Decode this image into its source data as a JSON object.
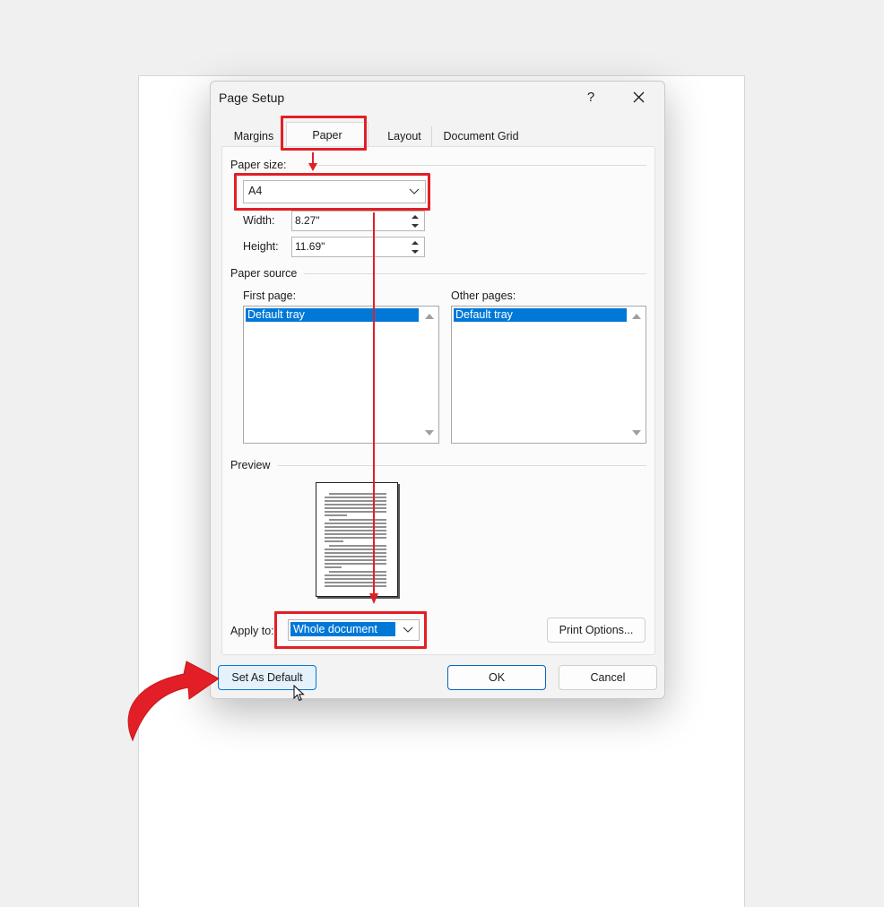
{
  "dialog": {
    "title": "Page Setup",
    "help_label": "?",
    "close_icon": "close-icon"
  },
  "tabs": [
    {
      "label": "Margins"
    },
    {
      "label": "Paper"
    },
    {
      "label": "Layout"
    },
    {
      "label": "Document Grid"
    }
  ],
  "paper_size": {
    "label": "Paper size:",
    "value": "A4",
    "width_label": "Width:",
    "width_value": "8.27\"",
    "height_label": "Height:",
    "height_value": "11.69\""
  },
  "paper_source": {
    "label": "Paper source",
    "first_page_label": "First page:",
    "first_page_selected": "Default tray",
    "other_pages_label": "Other pages:",
    "other_pages_selected": "Default tray"
  },
  "preview": {
    "label": "Preview"
  },
  "apply_to": {
    "label": "Apply to:",
    "value": "Whole document"
  },
  "buttons": {
    "print_options": "Print Options...",
    "set_as_default": "Set As Default",
    "ok": "OK",
    "cancel": "Cancel"
  },
  "annotation_color": "#e21f26",
  "selection_color": "#0078d7"
}
